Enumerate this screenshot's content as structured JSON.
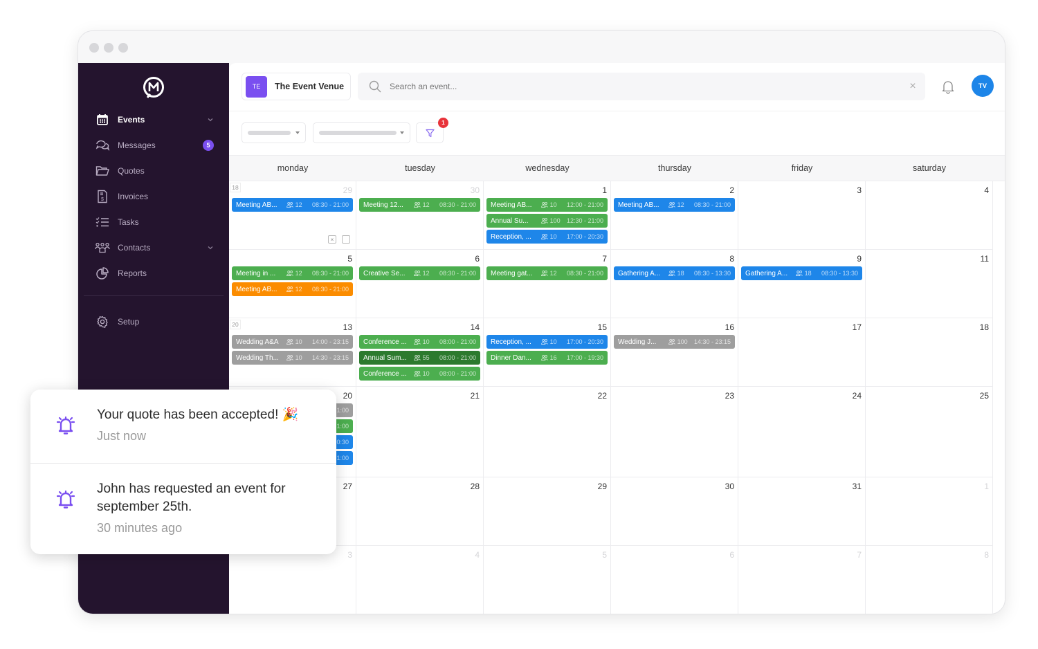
{
  "sidebar": {
    "items": [
      {
        "label": "Events",
        "icon": "calendar-icon",
        "active": true,
        "chevron": true
      },
      {
        "label": "Messages",
        "icon": "chat-icon",
        "badge": "5"
      },
      {
        "label": "Quotes",
        "icon": "folder-icon"
      },
      {
        "label": "Invoices",
        "icon": "invoice-icon"
      },
      {
        "label": "Tasks",
        "icon": "tasks-icon"
      },
      {
        "label": "Contacts",
        "icon": "contacts-icon",
        "chevron": true
      },
      {
        "label": "Reports",
        "icon": "pie-chart-icon"
      },
      {
        "label": "Setup",
        "icon": "gear-icon"
      }
    ]
  },
  "header": {
    "venue_initials": "TE",
    "venue_name": "The Event Venue",
    "search_placeholder": "Search an event...",
    "user_initials": "TV",
    "filter_badge": "1"
  },
  "colors": {
    "blue": "#1e86e9",
    "green": "#4cae4f",
    "dark_green": "#2c7a2e",
    "orange": "#fb8c00",
    "gray": "#9e9e9e",
    "accent": "#7a4ff0"
  },
  "calendar": {
    "days": [
      "monday",
      "tuesday",
      "wednesday",
      "thursday",
      "friday",
      "saturday"
    ],
    "weeks": [
      {
        "week": "18",
        "days": [
          {
            "num": "29",
            "muted": true,
            "events": [
              {
                "title": "Meeting AB...",
                "people": "12",
                "time": "08:30 - 21:00",
                "color": "blue"
              }
            ]
          },
          {
            "num": "30",
            "muted": true,
            "events": [
              {
                "title": "Meeting 12...",
                "people": "12",
                "time": "08:30 - 21:00",
                "color": "green"
              }
            ]
          },
          {
            "num": "1",
            "events": [
              {
                "title": "Meeting AB...",
                "people": "10",
                "time": "12:00 - 21:00",
                "color": "green"
              },
              {
                "title": "Annual Su...",
                "people": "100",
                "time": "12:30 - 21:00",
                "color": "green"
              },
              {
                "title": "Reception, ...",
                "people": "10",
                "time": "17:00 - 20:30",
                "color": "blue"
              }
            ]
          },
          {
            "num": "2",
            "events": [
              {
                "title": "Meeting AB...",
                "people": "12",
                "time": "08:30 - 21:00",
                "color": "blue"
              }
            ]
          },
          {
            "num": "3",
            "events": []
          },
          {
            "num": "4",
            "events": []
          }
        ]
      },
      {
        "week": "",
        "days": [
          {
            "num": "5",
            "events": [
              {
                "title": "Meeting in ...",
                "people": "12",
                "time": "08:30 - 21:00",
                "color": "green"
              },
              {
                "title": "Meeting AB...",
                "people": "12",
                "time": "08:30 - 21:00",
                "color": "orange"
              }
            ]
          },
          {
            "num": "6",
            "events": [
              {
                "title": "Creative Se...",
                "people": "12",
                "time": "08:30 - 21:00",
                "color": "green"
              }
            ]
          },
          {
            "num": "7",
            "events": [
              {
                "title": "Meeting gat...",
                "people": "12",
                "time": "08:30 - 21:00",
                "color": "green"
              }
            ]
          },
          {
            "num": "8",
            "events": [
              {
                "title": "Gathering A...",
                "people": "18",
                "time": "08:30 - 13:30",
                "color": "blue"
              }
            ]
          },
          {
            "num": "9",
            "events": [
              {
                "title": "Gathering A...",
                "people": "18",
                "time": "08:30 - 13:30",
                "color": "blue"
              }
            ]
          },
          {
            "num": "11",
            "events": []
          }
        ]
      },
      {
        "week": "20",
        "days": [
          {
            "num": "13",
            "events": [
              {
                "title": "Wedding A&A",
                "people": "10",
                "time": "14:00 - 23:15",
                "color": "gray"
              },
              {
                "title": "Wedding Th...",
                "people": "10",
                "time": "14:30 - 23:15",
                "color": "gray"
              }
            ]
          },
          {
            "num": "14",
            "events": [
              {
                "title": "Conference ...",
                "people": "10",
                "time": "08:00 - 21:00",
                "color": "green"
              },
              {
                "title": "Annual Sum...",
                "people": "55",
                "time": "08:00 - 21:00",
                "color": "dark_green"
              },
              {
                "title": "Conference ...",
                "people": "10",
                "time": "08:00 - 21:00",
                "color": "green"
              }
            ]
          },
          {
            "num": "15",
            "events": [
              {
                "title": "Reception, ...",
                "people": "10",
                "time": "17:00 - 20:30",
                "color": "blue"
              },
              {
                "title": "Dinner Dan...",
                "people": "16",
                "time": "17:00 - 19:30",
                "color": "green"
              }
            ]
          },
          {
            "num": "16",
            "events": [
              {
                "title": "Wedding J...",
                "people": "100",
                "time": "14:30 - 23:15",
                "color": "gray"
              }
            ]
          },
          {
            "num": "17",
            "events": []
          },
          {
            "num": "18",
            "events": []
          }
        ]
      },
      {
        "week": "",
        "days": [
          {
            "num": "20",
            "events": [
              {
                "title": "",
                "people": "",
                "time": "1:00",
                "color": "gray"
              },
              {
                "title": "",
                "people": "",
                "time": "1:00",
                "color": "green"
              },
              {
                "title": "",
                "people": "",
                "time": "0:30",
                "color": "blue"
              },
              {
                "title": "",
                "people": "",
                "time": "1:00",
                "color": "blue"
              }
            ]
          },
          {
            "num": "21",
            "events": []
          },
          {
            "num": "22",
            "events": []
          },
          {
            "num": "23",
            "events": []
          },
          {
            "num": "24",
            "events": []
          },
          {
            "num": "25",
            "events": []
          }
        ]
      },
      {
        "week": "",
        "days": [
          {
            "num": "27",
            "events": []
          },
          {
            "num": "28",
            "events": []
          },
          {
            "num": "29",
            "events": []
          },
          {
            "num": "30",
            "events": []
          },
          {
            "num": "31",
            "events": []
          },
          {
            "num": "1",
            "muted": true,
            "events": []
          }
        ]
      },
      {
        "week": "",
        "days": [
          {
            "num": "3",
            "muted": true,
            "events": []
          },
          {
            "num": "4",
            "muted": true,
            "events": []
          },
          {
            "num": "5",
            "muted": true,
            "events": []
          },
          {
            "num": "6",
            "muted": true,
            "events": []
          },
          {
            "num": "7",
            "muted": true,
            "events": []
          },
          {
            "num": "8",
            "muted": true,
            "events": []
          }
        ]
      }
    ]
  },
  "notifications": [
    {
      "message": "Your quote has been accepted! 🎉",
      "time": "Just now"
    },
    {
      "message": "John has requested an event for september 25th.",
      "time": "30 minutes ago"
    }
  ]
}
